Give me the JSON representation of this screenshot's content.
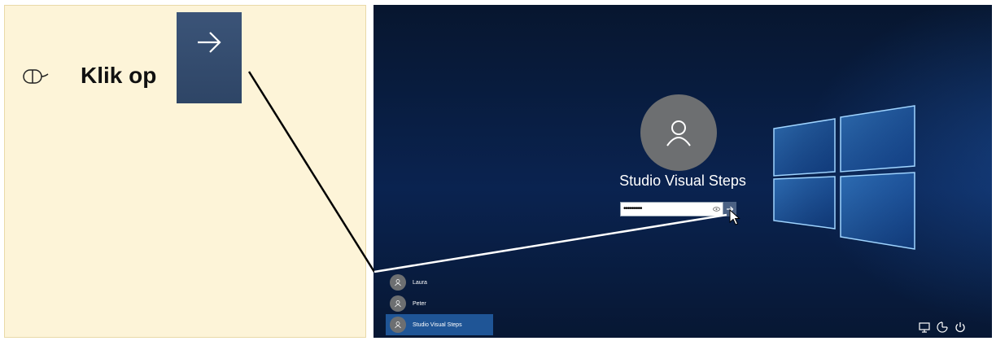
{
  "instruction": {
    "text": "Klik op"
  },
  "login": {
    "username": "Studio Visual Steps",
    "password_mask": "•••••••••"
  },
  "users": [
    {
      "name": "Laura",
      "selected": false
    },
    {
      "name": "Peter",
      "selected": false
    },
    {
      "name": "Studio Visual Steps",
      "selected": true
    }
  ],
  "icons": {
    "instruction": "mouse-icon",
    "callout": "arrow-right-icon",
    "avatar": "user-icon",
    "reveal": "eye-icon",
    "submit": "arrow-right-icon",
    "system": [
      "network-icon",
      "ease-of-access-icon",
      "power-icon"
    ]
  },
  "colors": {
    "tutorial_background": "#fdf4d8",
    "login_background": "#0a2350",
    "selected_user": "#1f5596",
    "submit_button": "#4b6184"
  }
}
